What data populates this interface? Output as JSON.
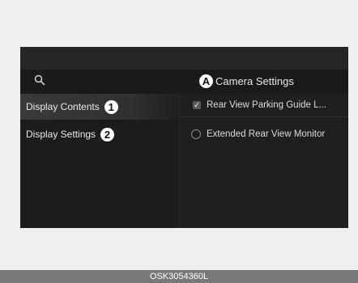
{
  "header": {
    "search_icon": "search-icon",
    "title_marker": "A",
    "title": "Camera Settings"
  },
  "menu": {
    "items": [
      {
        "label": "Display Contents",
        "marker": "1",
        "selected": true
      },
      {
        "label": "Display Settings",
        "marker": "2",
        "selected": false
      }
    ]
  },
  "options": {
    "items": [
      {
        "label": "Rear View Parking Guide L...",
        "control": "checkbox",
        "checked": true
      },
      {
        "label": "Extended Rear View Monitor",
        "control": "radio",
        "checked": false
      }
    ]
  },
  "caption": "OSK3054360L"
}
